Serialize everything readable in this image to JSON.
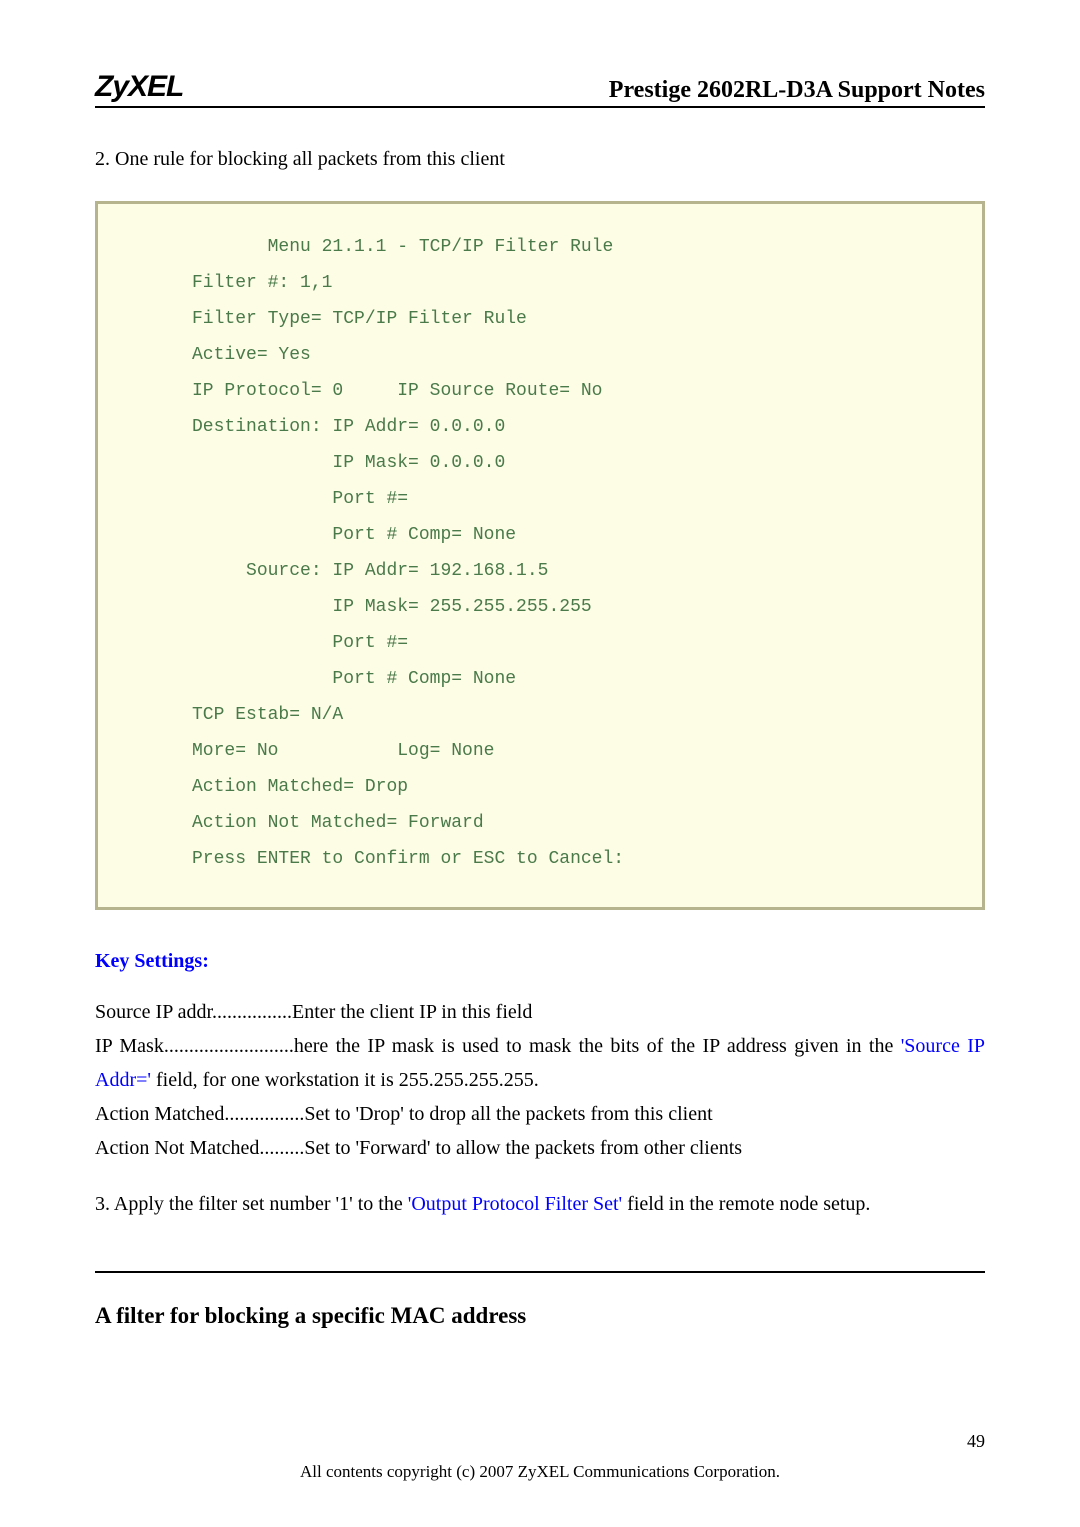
{
  "header": {
    "logo_text": "ZyXEL",
    "title": "Prestige 2602RL-D3A Support Notes"
  },
  "intro_line": "2. One rule for blocking all packets from this client",
  "code_block": "            Menu 21.1.1 - TCP/IP Filter Rule\n     Filter #: 1,1\n     Filter Type= TCP/IP Filter Rule\n     Active= Yes\n     IP Protocol= 0     IP Source Route= No\n     Destination: IP Addr= 0.0.0.0\n                  IP Mask= 0.0.0.0\n                  Port #=\n                  Port # Comp= None\n          Source: IP Addr= 192.168.1.5\n                  IP Mask= 255.255.255.255\n                  Port #=\n                  Port # Comp= None\n     TCP Estab= N/A\n     More= No           Log= None\n     Action Matched= Drop\n     Action Not Matched= Forward\n     Press ENTER to Confirm or ESC to Cancel:",
  "key_settings": {
    "heading": "Key Settings:",
    "line1": "Source IP addr................Enter the client IP in this field",
    "line2_prefix": "IP Mask..........................here the IP mask is used to mask the bits of the IP address given in the  ",
    "line2_highlight": "'Source IP Addr='",
    "line2_suffix": " field, for one workstation it is 255.255.255.255.",
    "line3": "Action Matched................Set to 'Drop' to drop all the packets from this client",
    "line4": "Action Not Matched.........Set to 'Forward' to allow the packets from other clients"
  },
  "apply_line": {
    "prefix": "3. Apply the filter set number '1' to the ",
    "highlight": "'Output Protocol Filter Set'",
    "suffix": " field in the remote node setup."
  },
  "subsection_heading": "A filter for blocking a specific MAC address",
  "page_number": "49",
  "footer": "All contents copyright (c) 2007 ZyXEL Communications Corporation."
}
